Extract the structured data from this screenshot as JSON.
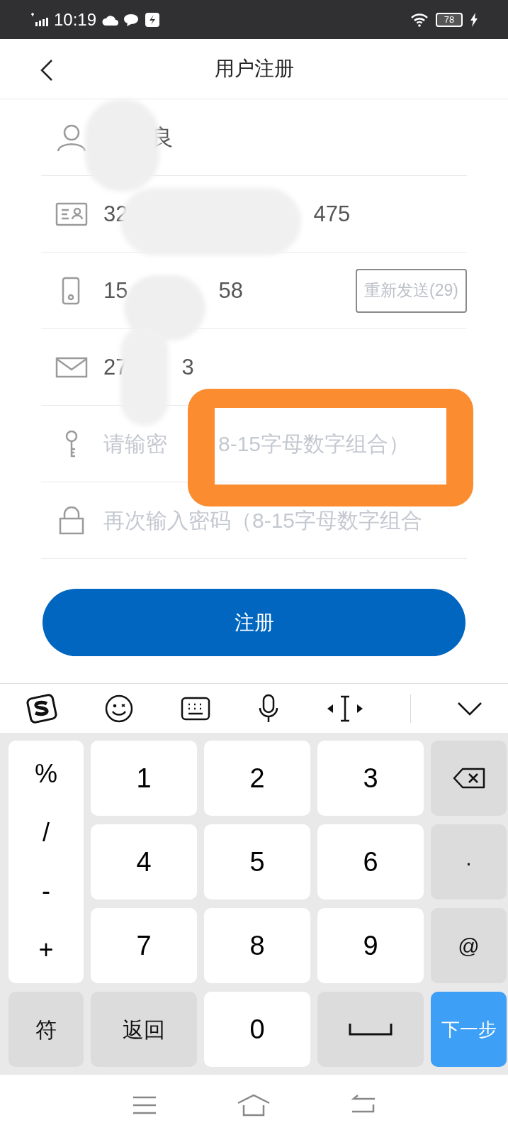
{
  "status_bar": {
    "time": "10:19",
    "battery": "78"
  },
  "header": {
    "title": "用户注册"
  },
  "form": {
    "rows": [
      {
        "kind": "value",
        "value_parts": [
          "良"
        ]
      },
      {
        "kind": "value",
        "value_parts": [
          "32",
          "475"
        ]
      },
      {
        "kind": "value",
        "value_parts": [
          "15",
          "58"
        ],
        "action": "重新发送(29)"
      },
      {
        "kind": "value",
        "value_parts": [
          "27",
          "3"
        ]
      },
      {
        "kind": "input",
        "placeholder_parts": [
          "请输密",
          "8-15字母数字组合）"
        ],
        "highlighted": true
      },
      {
        "kind": "input",
        "placeholder_parts": [
          "再次输入密码（8-15字母数字组合"
        ],
        "highlighted": false
      }
    ]
  },
  "submit": {
    "label": "注册"
  },
  "keyboard": {
    "symbols": [
      "%",
      "/",
      "-",
      "+"
    ],
    "keys": [
      {
        "kind": "digit",
        "label": "1"
      },
      {
        "kind": "digit",
        "label": "2"
      },
      {
        "kind": "digit",
        "label": "3"
      },
      {
        "kind": "delete"
      },
      {
        "kind": "digit",
        "label": "4"
      },
      {
        "kind": "digit",
        "label": "5"
      },
      {
        "kind": "digit",
        "label": "6"
      },
      {
        "kind": "function",
        "label": "·"
      },
      {
        "kind": "digit",
        "label": "7"
      },
      {
        "kind": "digit",
        "label": "8"
      },
      {
        "kind": "digit",
        "label": "9"
      },
      {
        "kind": "function",
        "label": "@"
      },
      {
        "kind": "function",
        "label": "符"
      },
      {
        "kind": "function",
        "label": "返回"
      },
      {
        "kind": "digit",
        "label": "0"
      },
      {
        "kind": "space"
      },
      {
        "kind": "action",
        "label": "下一步"
      }
    ]
  }
}
